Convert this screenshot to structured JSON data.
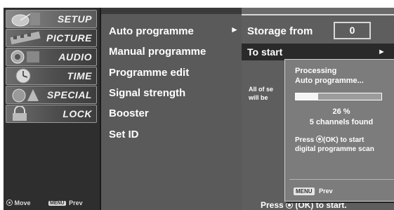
{
  "sidebar": {
    "categories": [
      {
        "label": "SETUP",
        "icon": "satellite-dish-icon",
        "selected": true
      },
      {
        "label": "PICTURE",
        "icon": "film-reel-icon",
        "selected": false
      },
      {
        "label": "AUDIO",
        "icon": "speaker-icon",
        "selected": false
      },
      {
        "label": "TIME",
        "icon": "clock-icon",
        "selected": false
      },
      {
        "label": "SPECIAL",
        "icon": "special-shapes-icon",
        "selected": false
      },
      {
        "label": "LOCK",
        "icon": "padlock-icon",
        "selected": false
      }
    ],
    "footer": {
      "move_label": "Move",
      "menu_button": "MENU",
      "prev_label": "Prev"
    }
  },
  "submenu": {
    "items": [
      {
        "label": "Auto programme",
        "selected": true
      },
      {
        "label": "Manual programme",
        "selected": false
      },
      {
        "label": "Programme edit",
        "selected": false
      },
      {
        "label": "Signal strength",
        "selected": false
      },
      {
        "label": "Booster",
        "selected": false
      },
      {
        "label": "Set ID",
        "selected": false
      }
    ],
    "arrow": "►"
  },
  "right_panel": {
    "storage_label": "Storage from",
    "storage_value": "0",
    "to_start_label": "To start",
    "to_start_arrow": "►",
    "info_line1": "All of se",
    "info_line2": "will be",
    "bottom_press": "Press",
    "bottom_rest": "(OK) to start."
  },
  "popup": {
    "title_line1": "Processing",
    "title_line2": "Auto programme...",
    "progress_percent": 26,
    "percent_text": "26 %",
    "channels_text": "5 channels found",
    "press_line1": "Press",
    "press_line1_rest": "(OK) to start",
    "press_line2": "digital programme scan",
    "menu_button": "MENU",
    "prev_label": "Prev"
  },
  "colors": {
    "background": "#4a4a4a",
    "sidebar": "#2e2e2e",
    "selected_row": "#2a2a2a",
    "popup": "#7c7c7c",
    "progress_fill": "#f4f4f4"
  }
}
